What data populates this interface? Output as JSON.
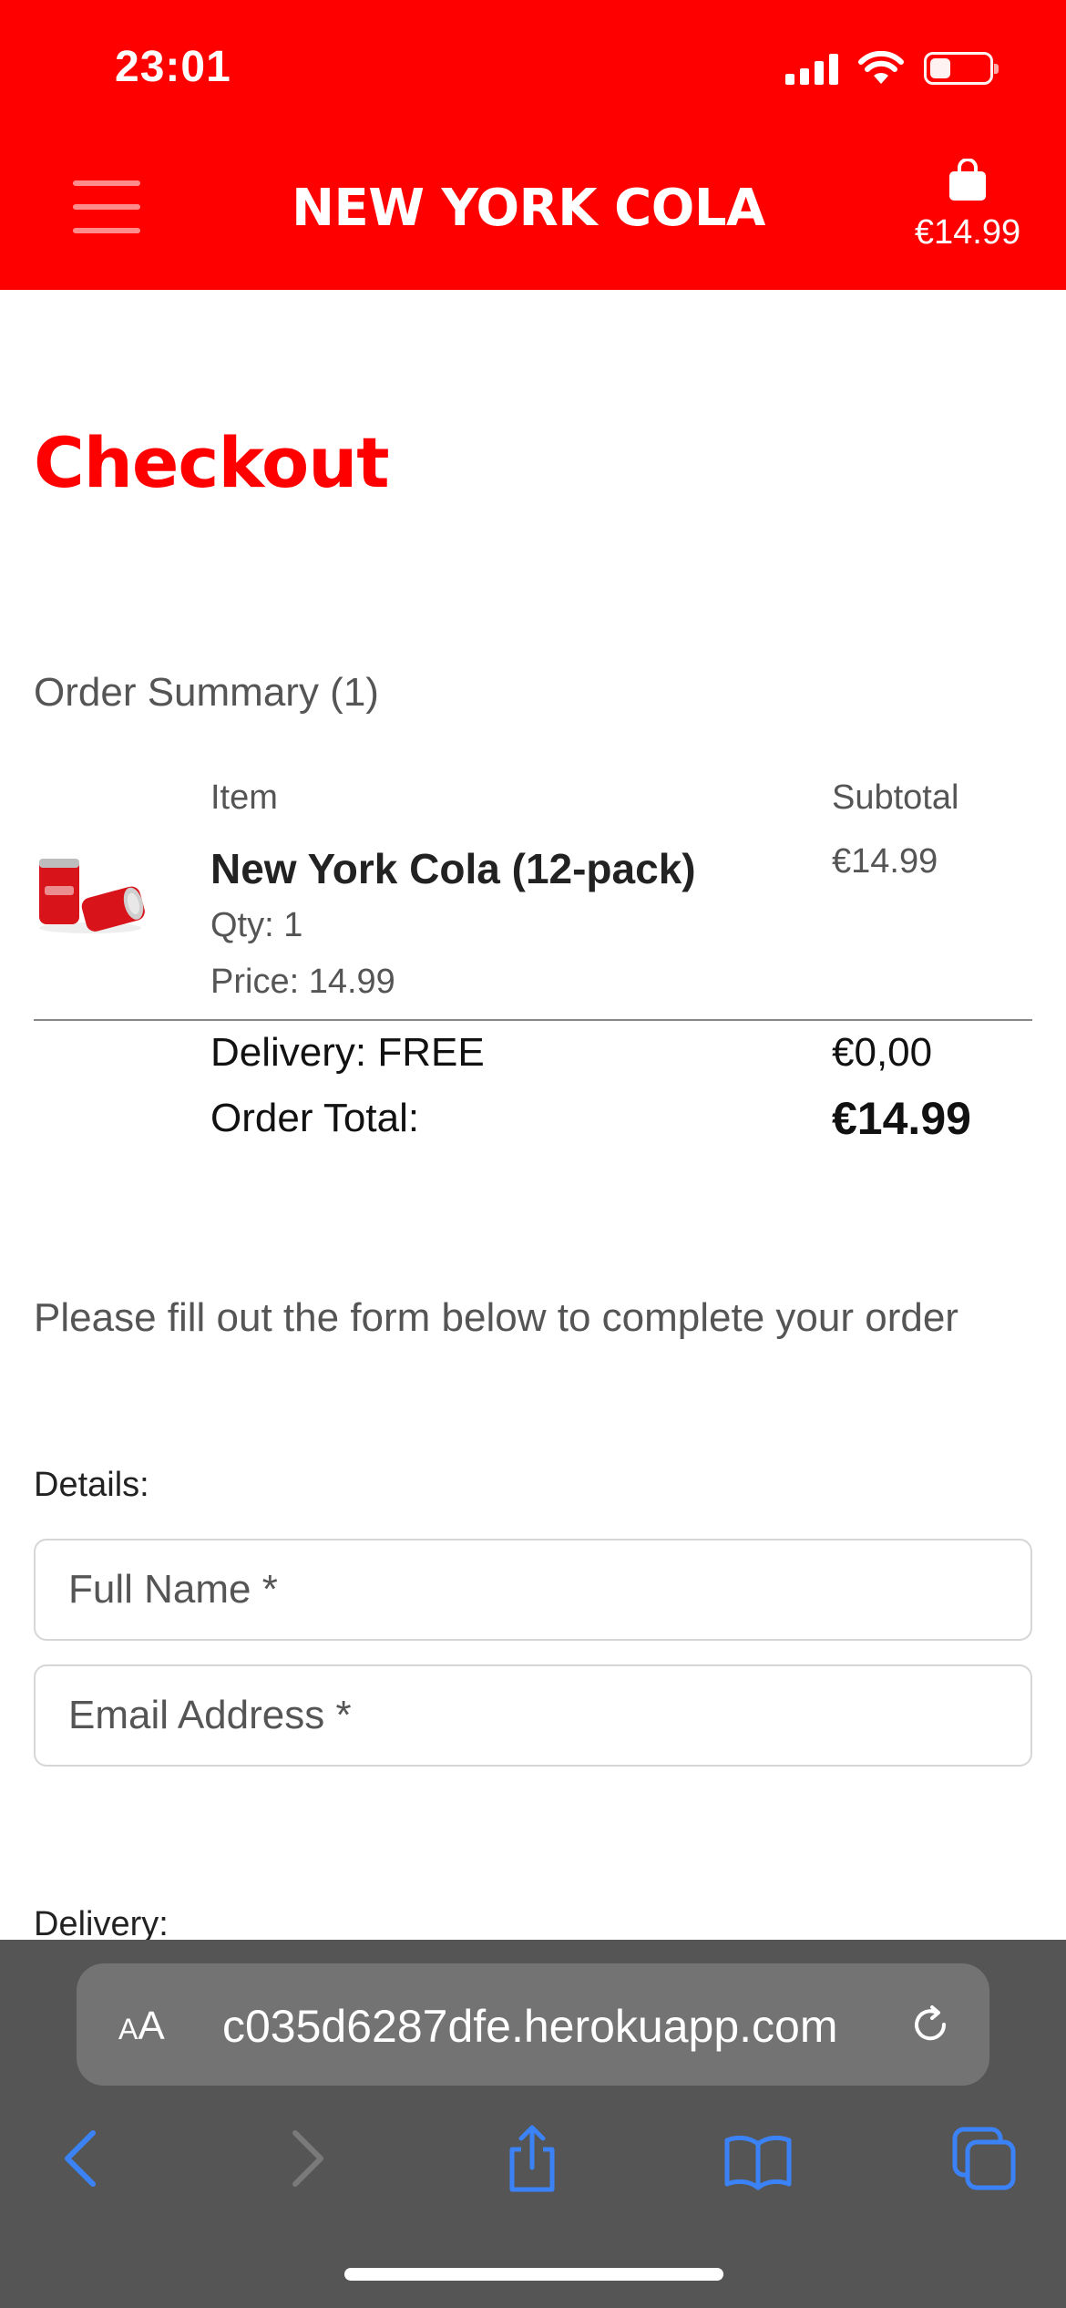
{
  "status": {
    "time": "23:01"
  },
  "header": {
    "brand": "NEW YORK COLA",
    "cart_total": "€14.99"
  },
  "page": {
    "title": "Checkout"
  },
  "summary": {
    "title": "Order Summary (1)",
    "col_item": "Item",
    "col_subtotal": "Subtotal",
    "product": {
      "name": "New York Cola (12-pack)",
      "qty": "Qty: 1",
      "price": "Price: 14.99",
      "subtotal": "€14.99"
    },
    "delivery_label": "Delivery: FREE",
    "delivery_value": "€0,00",
    "total_label": "Order Total:",
    "total_value": "€14.99"
  },
  "form": {
    "instructions": "Please fill out the form below to complete your order",
    "details_label": "Details:",
    "full_name_placeholder": "Full Name *",
    "email_placeholder": "Email Address *",
    "delivery_label": "Delivery:"
  },
  "browser": {
    "aa_label_small": "A",
    "aa_label_large": "A",
    "url": "c035d6287dfe.herokuapp.com"
  },
  "colors": {
    "brand_red": "#ff0000",
    "safari_blue": "#3b82f6"
  }
}
